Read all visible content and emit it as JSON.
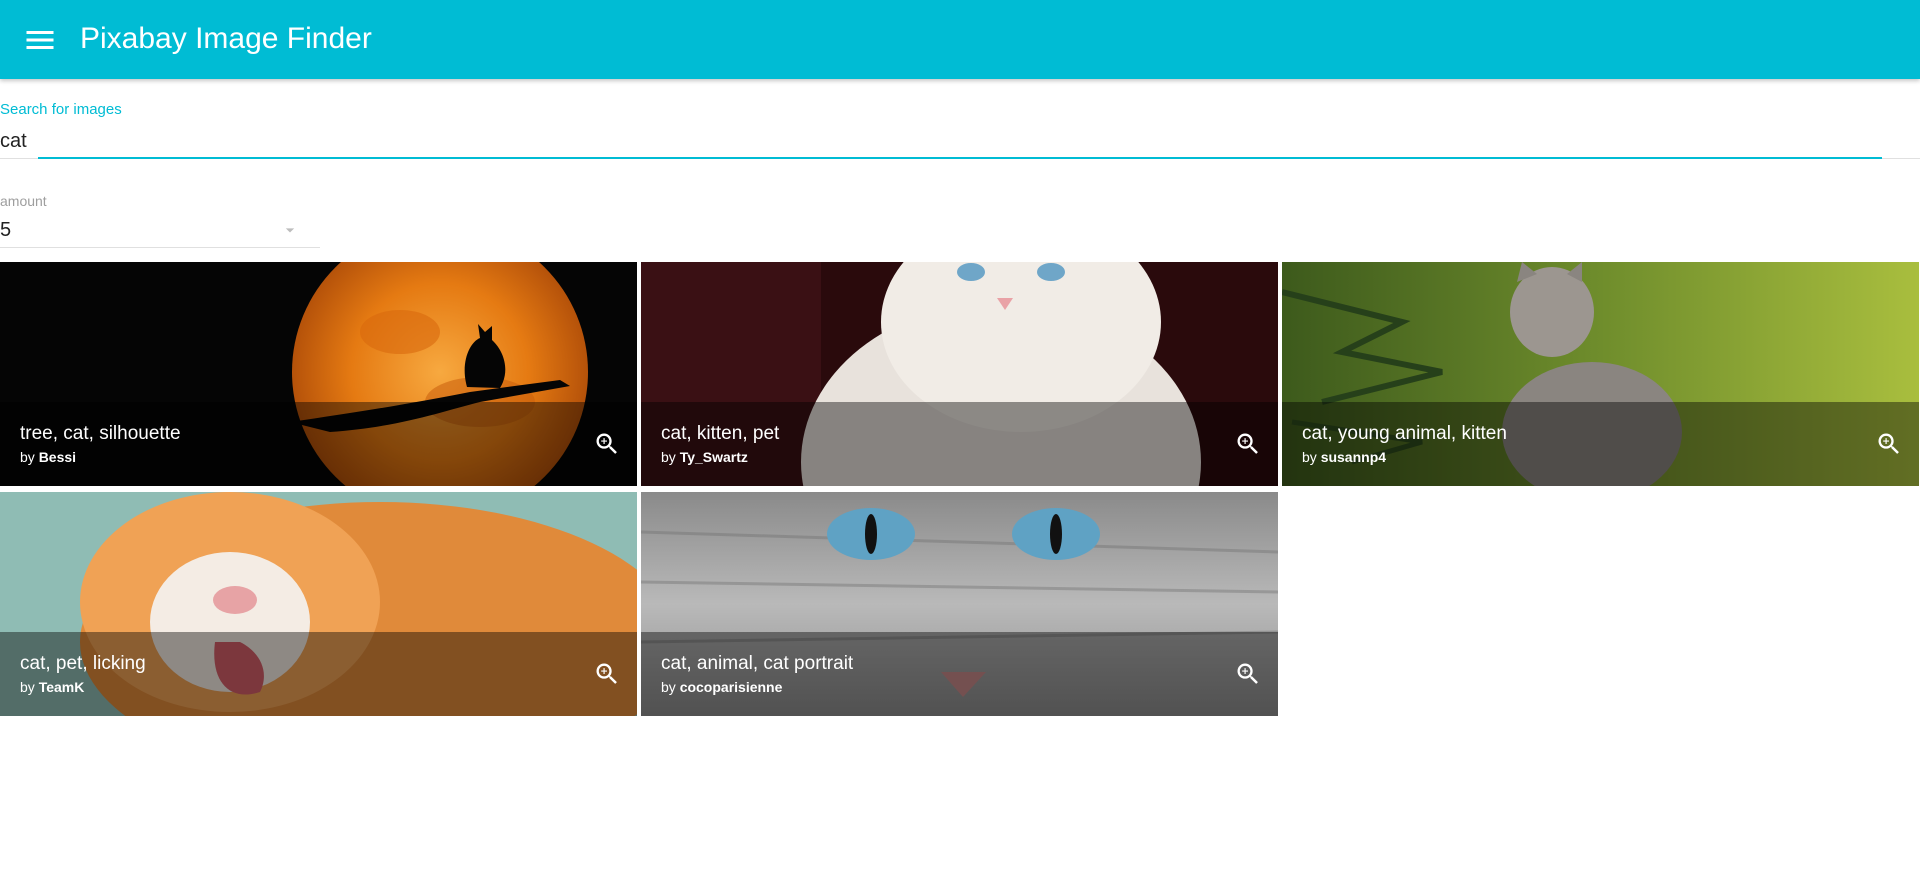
{
  "app": {
    "title": "Pixabay Image Finder",
    "accent_color": "#00bcd4",
    "menu_icon": "menu-icon"
  },
  "search": {
    "label": "Search for images",
    "value": "cat"
  },
  "amount": {
    "label": "amount",
    "value": "5"
  },
  "images": [
    {
      "tags": "tree, cat, silhouette",
      "by": "by",
      "user": "Bessi",
      "icon": "zoom-in-icon"
    },
    {
      "tags": "cat, kitten, pet",
      "by": "by",
      "user": "Ty_Swartz",
      "icon": "zoom-in-icon"
    },
    {
      "tags": "cat, young animal, kitten",
      "by": "by",
      "user": "susannp4",
      "icon": "zoom-in-icon"
    },
    {
      "tags": "cat, pet, licking",
      "by": "by",
      "user": "TeamK",
      "icon": "zoom-in-icon"
    },
    {
      "tags": "cat, animal, cat portrait",
      "by": "by",
      "user": "cocoparisienne",
      "icon": "zoom-in-icon"
    }
  ]
}
